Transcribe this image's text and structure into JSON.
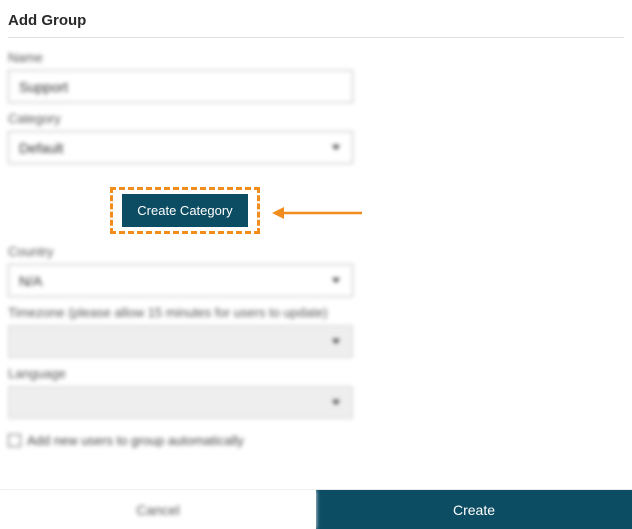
{
  "dialog": {
    "title": "Add Group"
  },
  "fields": {
    "name": {
      "label": "Name",
      "value": "Support"
    },
    "category": {
      "label": "Category",
      "value": "Default"
    },
    "country": {
      "label": "Country",
      "value": "N/A"
    },
    "timezone": {
      "label": "Timezone (please allow 15 minutes for users to update)",
      "value": ""
    },
    "language": {
      "label": "Language",
      "value": ""
    }
  },
  "checkbox": {
    "label": "Add new users to group automatically",
    "checked": false
  },
  "buttons": {
    "create_category": "Create Category",
    "cancel": "Cancel",
    "create": "Create"
  },
  "callout": {
    "color": "#f28c1d"
  }
}
